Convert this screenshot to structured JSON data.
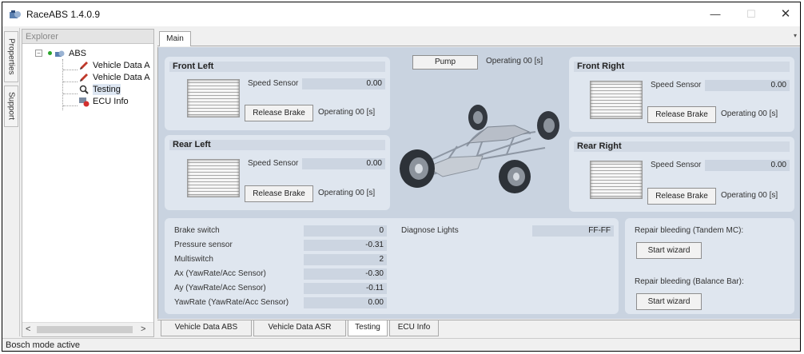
{
  "window": {
    "title": "RaceABS 1.4.0.9",
    "minimize": "—",
    "maximize": "☐",
    "close": "✕"
  },
  "side_tabs": [
    "Properties",
    "Support"
  ],
  "explorer": {
    "header": "Explorer",
    "toggle": "−",
    "root": "ABS",
    "items": [
      "Vehicle Data A",
      "Vehicle Data A",
      "Testing",
      "ECU Info"
    ],
    "scroll_left": "<",
    "scroll_right": ">"
  },
  "tabs": {
    "main": "Main",
    "overflow": "▾"
  },
  "wheels": {
    "front_left": {
      "title": "Front Left",
      "speed_label": "Speed Sensor",
      "speed_value": "0.00",
      "button": "Release Brake",
      "operating": "Operating 00 [s]"
    },
    "rear_left": {
      "title": "Rear Left",
      "speed_label": "Speed Sensor",
      "speed_value": "0.00",
      "button": "Release Brake",
      "operating": "Operating 00 [s]"
    },
    "front_right": {
      "title": "Front Right",
      "speed_label": "Speed Sensor",
      "speed_value": "0.00",
      "button": "Release Brake",
      "operating": "Operating 00 [s]"
    },
    "rear_right": {
      "title": "Rear Right",
      "speed_label": "Speed Sensor",
      "speed_value": "0.00",
      "button": "Release Brake",
      "operating": "Operating 00 [s]"
    }
  },
  "pump": {
    "button": "Pump",
    "operating": "Operating 00 [s]"
  },
  "sensors": [
    {
      "label": "Brake switch",
      "value": "0"
    },
    {
      "label": "Pressure sensor",
      "value": "-0.31"
    },
    {
      "label": "Multiswitch",
      "value": "2"
    },
    {
      "label": "Ax (YawRate/Acc Sensor)",
      "value": "-0.30"
    },
    {
      "label": "Ay (YawRate/Acc Sensor)",
      "value": "-0.11"
    },
    {
      "label": "YawRate (YawRate/Acc Sensor)",
      "value": "0.00"
    }
  ],
  "diagnose": {
    "label": "Diagnose Lights",
    "value": "FF-FF"
  },
  "repair": {
    "tandem_label": "Repair bleeding (Tandem MC):",
    "tandem_button": "Start wizard",
    "balance_label": "Repair bleeding (Balance Bar):",
    "balance_button": "Start wizard"
  },
  "bottom_tabs": [
    "Vehicle Data ABS",
    "Vehicle Data ASR",
    "Testing",
    "ECU Info"
  ],
  "status": "Bosch mode active",
  "colors": {
    "content_bg": "#c9d3e0",
    "panel_bg": "#dfe6ef",
    "tree_dot": "#2aa52a"
  }
}
